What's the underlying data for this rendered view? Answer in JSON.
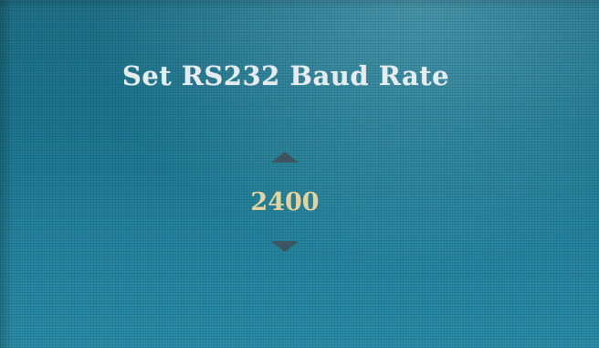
{
  "menu": {
    "title": "Set RS232 Baud Rate"
  },
  "selector": {
    "value": "2400",
    "up_icon": "triangle-up-icon",
    "down_icon": "triangle-down-icon"
  },
  "colors": {
    "background": "#1d7790",
    "title_text": "#e6ecee",
    "value_text": "#e4d39e",
    "arrow": "#3c5560"
  }
}
